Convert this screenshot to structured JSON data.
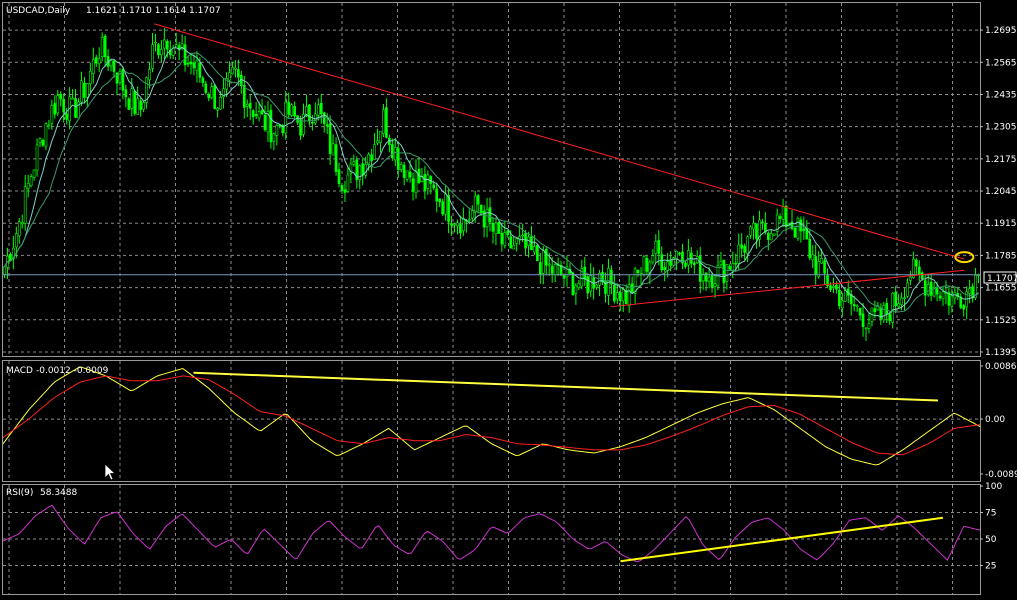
{
  "symbol": "USDCAD,Daily",
  "ohlc_text": "1.1621 1.1710 1.1614 1.1707",
  "current_price_label": "1.1707",
  "macd": {
    "label": "MACD",
    "values_text": "-0.0012 -0.0009"
  },
  "rsi": {
    "label": "RSI(9)",
    "values_text": "58.3488"
  },
  "colors": {
    "background": "#000000",
    "grid": "#8a8a8a",
    "candles": "#00ff00",
    "ma_fast": "#7fd3c8",
    "ma_slow": "#3a9a6a",
    "trendline": "#ff2020",
    "macd_main": "#ffff40",
    "macd_signal": "#ff2020",
    "rsi_line": "#cc33cc",
    "rsi_trendline": "#ffff00",
    "highlight": "#ffd700",
    "price_line": "#7799bb"
  },
  "chart_data": [
    {
      "type": "candlestick",
      "title": "USDCAD,Daily",
      "ylim": [
        1.1395,
        1.276
      ],
      "y_ticks": [
        "1.2695",
        "1.2565",
        "1.2435",
        "1.2305",
        "1.2175",
        "1.2045",
        "1.1915",
        "1.1785",
        "1.1655",
        "1.1525",
        "1.1395"
      ],
      "current_price": 1.1707,
      "close_profile": [
        1.174,
        1.19,
        1.212,
        1.231,
        1.243,
        1.236,
        1.247,
        1.262,
        1.256,
        1.244,
        1.236,
        1.262,
        1.267,
        1.259,
        1.255,
        1.246,
        1.239,
        1.252,
        1.241,
        1.233,
        1.229,
        1.236,
        1.231,
        1.24,
        1.224,
        1.209,
        1.213,
        1.22,
        1.234,
        1.219,
        1.211,
        1.207,
        1.203,
        1.196,
        1.192,
        1.199,
        1.189,
        1.182,
        1.183,
        1.179,
        1.174,
        1.171,
        1.168,
        1.167,
        1.171,
        1.166,
        1.162,
        1.172,
        1.18,
        1.176,
        1.182,
        1.174,
        1.171,
        1.172,
        1.178,
        1.185,
        1.188,
        1.192,
        1.193,
        1.186,
        1.175,
        1.167,
        1.161,
        1.157,
        1.152,
        1.154,
        1.161,
        1.172,
        1.168,
        1.165,
        1.161,
        1.163,
        1.1707
      ],
      "trendlines": [
        {
          "from": [
            0.155,
            1.272
          ],
          "to": [
            0.984,
            1.177
          ]
        },
        {
          "from": [
            0.622,
            1.1578
          ],
          "to": [
            0.984,
            1.1725
          ]
        }
      ]
    },
    {
      "type": "line",
      "title": "MACD",
      "ylim": [
        -0.0089,
        0.0086
      ],
      "y_ticks": [
        "0.0086",
        "0.00",
        "-0.0089"
      ],
      "series": [
        {
          "name": "main",
          "values": [
            -0.004,
            0.0015,
            0.006,
            0.0085,
            0.007,
            0.0045,
            0.007,
            0.0082,
            0.005,
            0.001,
            -0.002,
            0.001,
            -0.0035,
            -0.006,
            -0.004,
            -0.0015,
            -0.005,
            -0.003,
            -0.001,
            -0.004,
            -0.006,
            -0.004,
            -0.005,
            -0.0055,
            -0.0045,
            -0.003,
            -0.001,
            0.001,
            0.0025,
            0.0035,
            0.0015,
            -0.0015,
            -0.0045,
            -0.0065,
            -0.0075,
            -0.005,
            -0.002,
            0.001,
            -0.0012
          ]
        },
        {
          "name": "signal",
          "values": [
            -0.003,
            0.0,
            0.0035,
            0.006,
            0.007,
            0.0062,
            0.0062,
            0.007,
            0.0064,
            0.004,
            0.0012,
            0.0005,
            -0.0015,
            -0.0035,
            -0.004,
            -0.003,
            -0.0035,
            -0.0035,
            -0.0025,
            -0.003,
            -0.004,
            -0.0042,
            -0.0046,
            -0.005,
            -0.005,
            -0.0042,
            -0.0028,
            -0.0012,
            0.0006,
            0.002,
            0.0022,
            0.0008,
            -0.0015,
            -0.0038,
            -0.0055,
            -0.0058,
            -0.004,
            -0.0015,
            -0.0009
          ]
        }
      ],
      "trendlines": [
        {
          "from": [
            0.195,
            0.0075
          ],
          "to": [
            0.957,
            0.003
          ]
        }
      ]
    },
    {
      "type": "line",
      "title": "RSI(9)",
      "ylim": [
        0,
        100
      ],
      "y_ticks": [
        "100",
        "75",
        "50",
        "25"
      ],
      "series": [
        {
          "name": "RSI",
          "values": [
            48,
            55,
            72,
            82,
            60,
            45,
            70,
            76,
            55,
            40,
            62,
            74,
            58,
            42,
            50,
            35,
            60,
            45,
            30,
            55,
            68,
            52,
            40,
            64,
            44,
            35,
            58,
            48,
            30,
            40,
            62,
            55,
            70,
            74,
            66,
            50,
            40,
            48,
            35,
            28,
            40,
            56,
            72,
            44,
            30,
            52,
            66,
            70,
            58,
            40,
            30,
            46,
            68,
            70,
            58,
            72,
            60,
            45,
            30,
            62,
            58.35
          ]
        }
      ],
      "trendlines": [
        {
          "from": [
            0.632,
            29
          ],
          "to": [
            0.962,
            70
          ]
        }
      ]
    }
  ]
}
